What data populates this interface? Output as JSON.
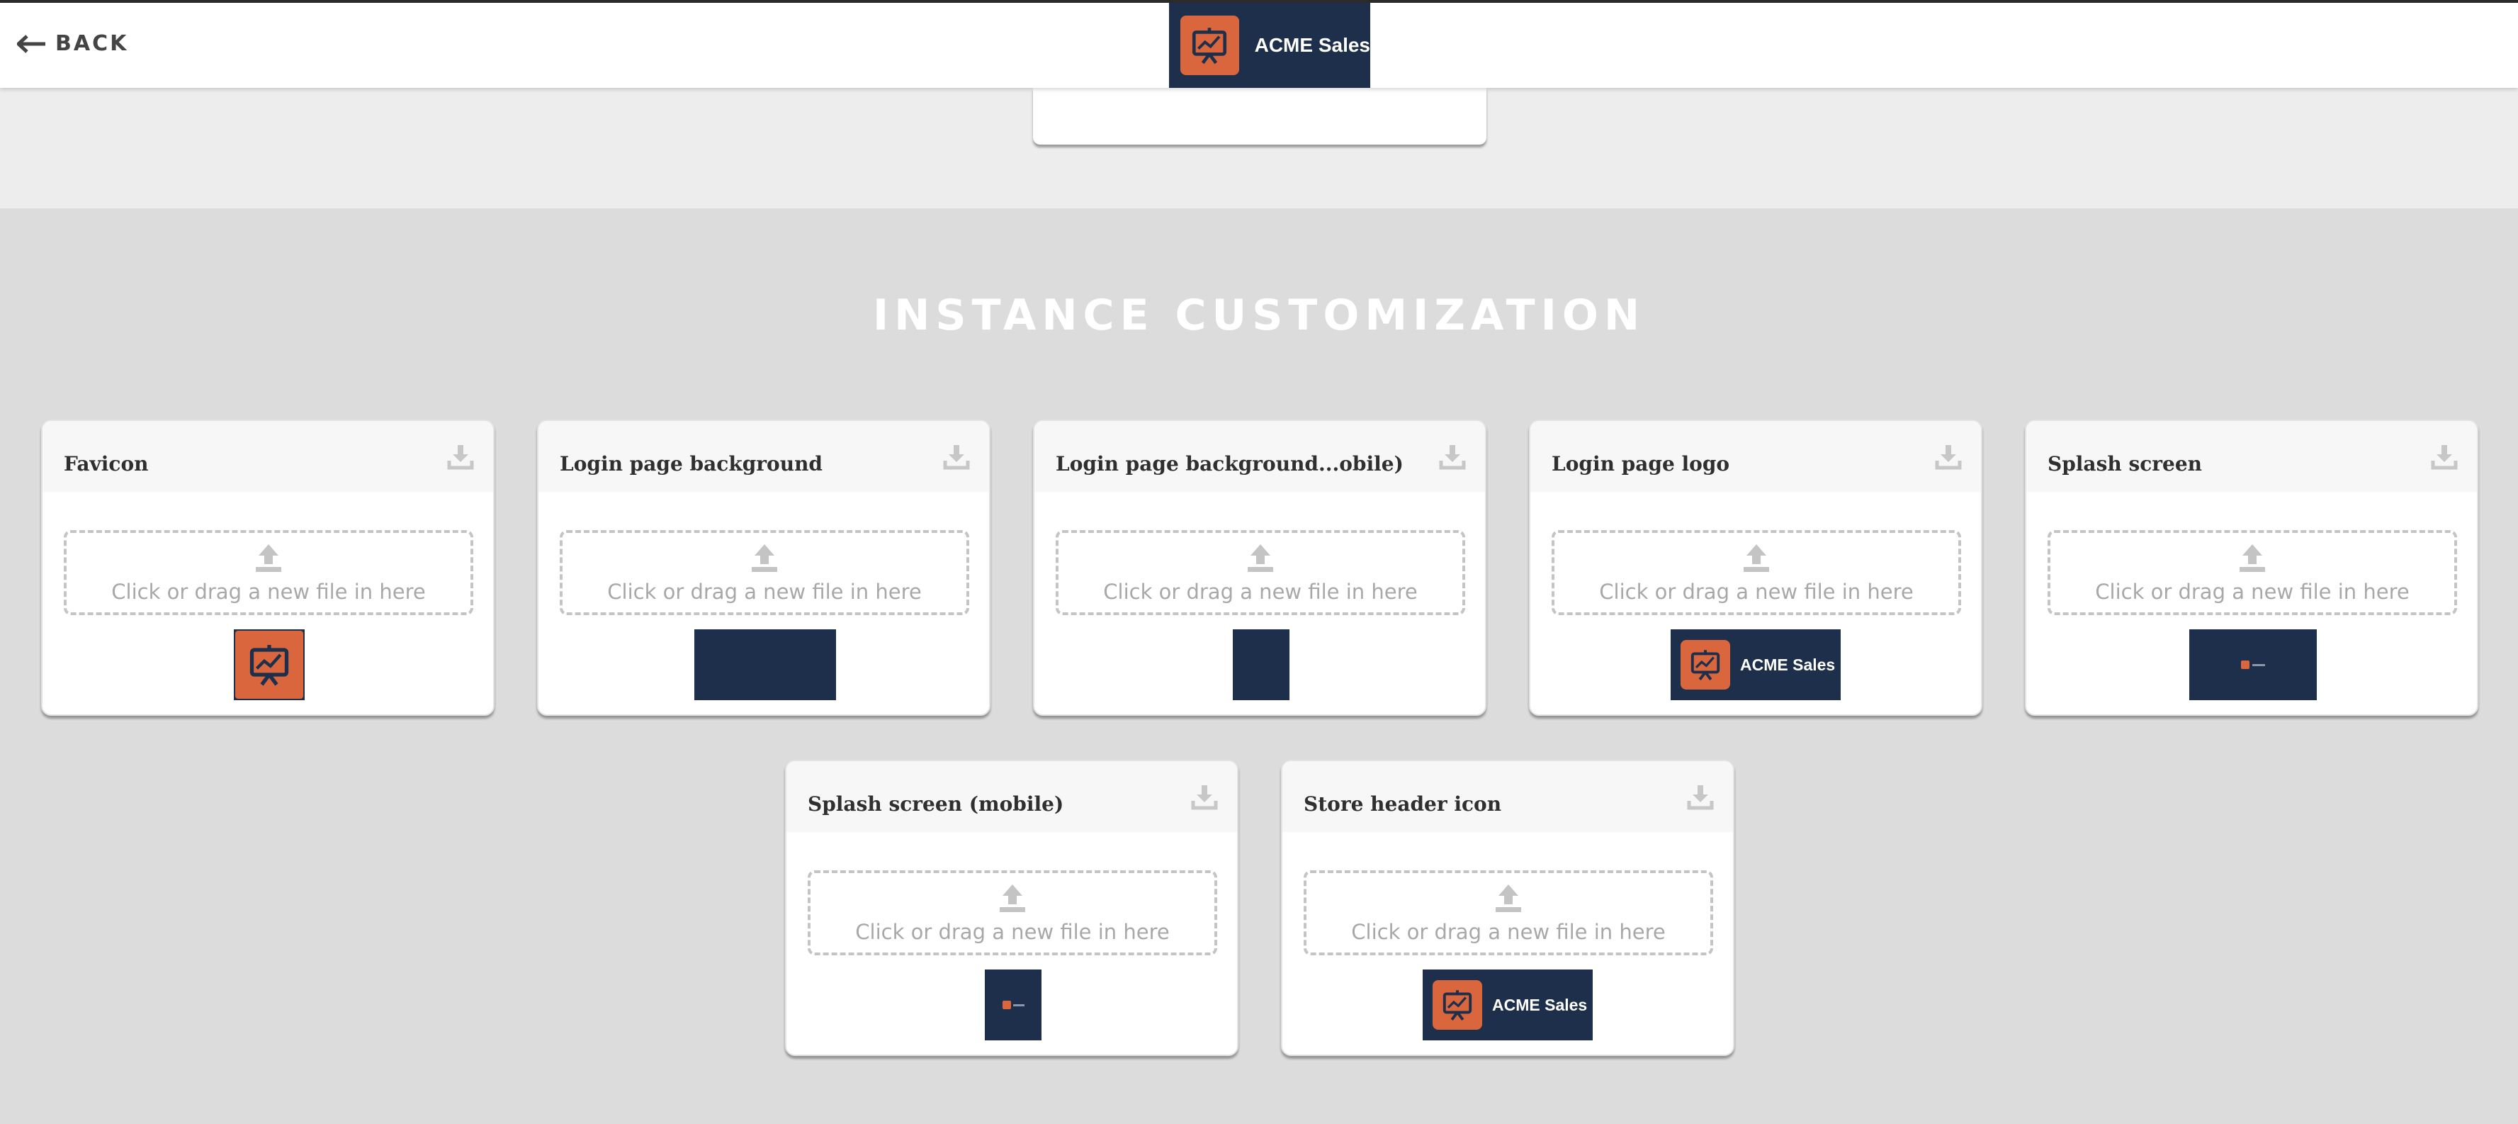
{
  "topbar": {
    "back_label": "BACK",
    "brand_name": "ACME Sales"
  },
  "colors": {
    "brand_navy": "#1d2f4a",
    "brand_orange": "#d9663c"
  },
  "section": {
    "title": "INSTANCE CUSTOMIZATION"
  },
  "cards": [
    {
      "title": "Favicon",
      "drop_text": "Click or drag a new file in here",
      "preview": "favicon-logo"
    },
    {
      "title": "Login page background",
      "drop_text": "Click or drag a new file in here",
      "preview": "navy-background"
    },
    {
      "title": "Login page background...obile)",
      "drop_text": "Click or drag a new file in here",
      "preview": "navy-background-mobile"
    },
    {
      "title": "Login page logo",
      "drop_text": "Click or drag a new file in here",
      "preview": "acme-logo-with-text",
      "preview_text": "ACME Sales"
    },
    {
      "title": "Splash screen",
      "drop_text": "Click or drag a new file in here",
      "preview": "splash-thumbnail"
    },
    {
      "title": "Splash screen (mobile)",
      "drop_text": "Click or drag a new file in here",
      "preview": "splash-thumbnail-mobile"
    },
    {
      "title": "Store header icon",
      "drop_text": "Click or drag a new file in here",
      "preview": "acme-logo-with-text",
      "preview_text": "ACME Sales"
    }
  ],
  "icons": {
    "back": "arrow-left-icon",
    "download": "download-icon",
    "upload": "upload-icon",
    "logo": "presentation-chart-icon"
  }
}
